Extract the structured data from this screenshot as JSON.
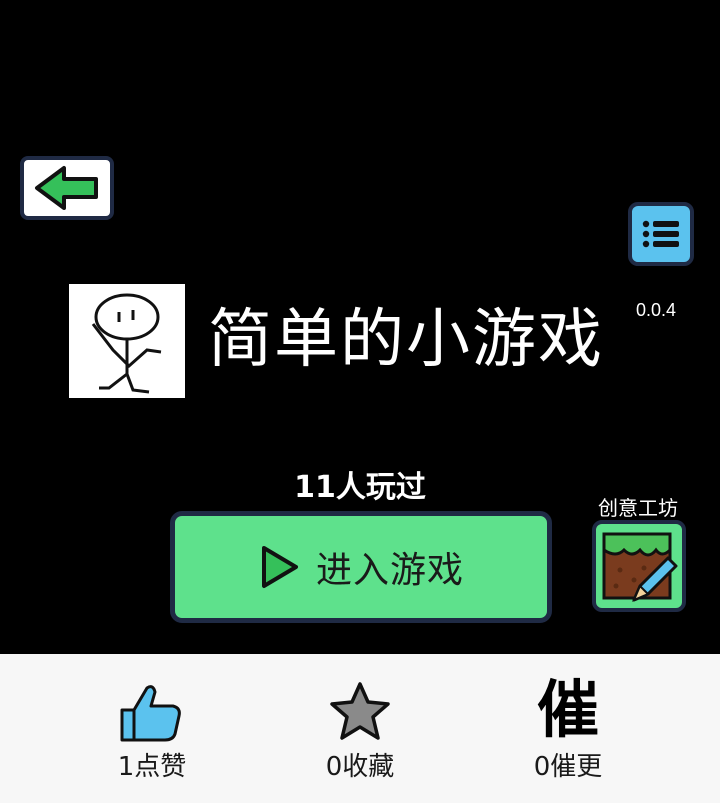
{
  "game": {
    "title": "简单的小游戏",
    "version": "0.0.4",
    "played_count": "11人玩过"
  },
  "actions": {
    "enter_label": "进入游戏",
    "workshop_label": "创意工坊"
  },
  "bottom_bar": {
    "like_label": "1点赞",
    "favorite_label": "0收藏",
    "urge_label": "0催更",
    "urge_glyph": "催"
  },
  "colors": {
    "accent_green": "#5ee18c",
    "accent_blue": "#5bc2ee",
    "border_navy": "#1f2a44"
  },
  "icons": [
    "back-arrow-icon",
    "menu-list-icon",
    "play-icon",
    "workshop-edit-icon",
    "thumbs-up-icon",
    "star-icon"
  ]
}
